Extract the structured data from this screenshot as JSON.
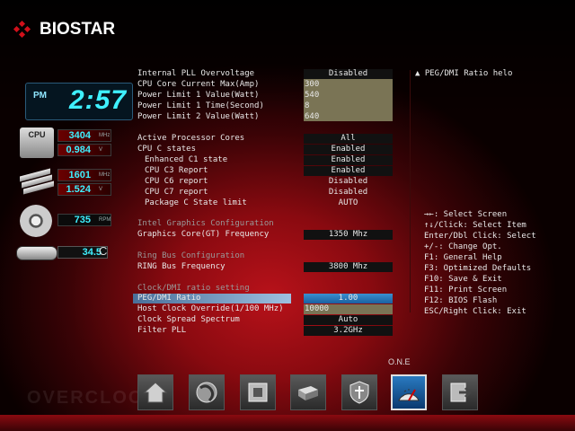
{
  "brand": {
    "name": "BIOSTAR"
  },
  "status_panel": {
    "clock_ampm": "PM",
    "clock_time": "2:57",
    "cpu_label": "CPU",
    "cpu_freq": "3404",
    "cpu_freq_unit": "MHz",
    "cpu_volt": "0.984",
    "cpu_volt_unit": "V",
    "mem_freq": "1601",
    "mem_freq_unit": "MHz",
    "mem_volt": "1.524",
    "mem_volt_unit": "V",
    "fan_speed": "735",
    "fan_unit": "RPM",
    "temp_value": "34.5",
    "temp_unit": "C"
  },
  "settings": {
    "internal_pll": {
      "label": "Internal PLL Overvoltage",
      "value": "Disabled"
    },
    "cpu_core_current": {
      "label": "CPU Core Current Max(Amp)",
      "value": "300"
    },
    "power_limit_1_value": {
      "label": "Power Limit 1 Value(Watt)",
      "value": "540"
    },
    "power_limit_1_time": {
      "label": "Power Limit 1 Time(Second)",
      "value": "8"
    },
    "power_limit_2_value": {
      "label": "Power Limit 2 Value(Watt)",
      "value": "640"
    },
    "active_cores": {
      "label": "Active Processor Cores",
      "value": "All"
    },
    "cpu_c_states": {
      "label": "CPU C states",
      "value": "Enabled"
    },
    "enhanced_c1": {
      "label": "Enhanced C1 state",
      "value": "Enabled"
    },
    "cpu_c3": {
      "label": "CPU C3 Report",
      "value": "Enabled"
    },
    "cpu_c6": {
      "label": "CPU C6 report",
      "value": "Disabled"
    },
    "cpu_c7": {
      "label": "CPU C7 report",
      "value": "Disabled"
    },
    "package_c": {
      "label": "Package C State limit",
      "value": "AUTO"
    },
    "section_igfx": "Intel Graphics Configuration",
    "graphics_freq": {
      "label": "Graphics Core(GT) Frequency",
      "value": "1350 Mhz"
    },
    "section_ring": "Ring Bus Configuration",
    "ring_freq": {
      "label": "RING Bus Frequency",
      "value": "3800 Mhz"
    },
    "section_clock": "Clock/DMI ratio setting",
    "peg_dmi": {
      "label": "PEG/DMI Ratio",
      "value": "1.00"
    },
    "host_clock": {
      "label": "Host Clock Override(1/100 MHz)",
      "value": "10000"
    },
    "clock_spread": {
      "label": "Clock Spread Spectrum",
      "value": "Auto"
    },
    "filter_pll": {
      "label": "Filter PLL",
      "value": "3.2GHz"
    }
  },
  "help": {
    "title": "PEG/DMI Ratio helo",
    "keys": [
      "→←: Select Screen",
      "↑↓/Click: Select Item",
      "Enter/Dbl Click: Select",
      "+/-: Change Opt.",
      "F1: General Help",
      "F3: Optimized Defaults",
      "F10: Save & Exit",
      "F11: Print Screen",
      "F12: BIOS Flash",
      "ESC/Right Click: Exit"
    ]
  },
  "nav": {
    "active_label": "O.N.E",
    "icons": [
      "home-icon",
      "performance-icon",
      "chipset-icon",
      "storage-icon",
      "security-icon",
      "one-icon",
      "exit-icon"
    ]
  }
}
